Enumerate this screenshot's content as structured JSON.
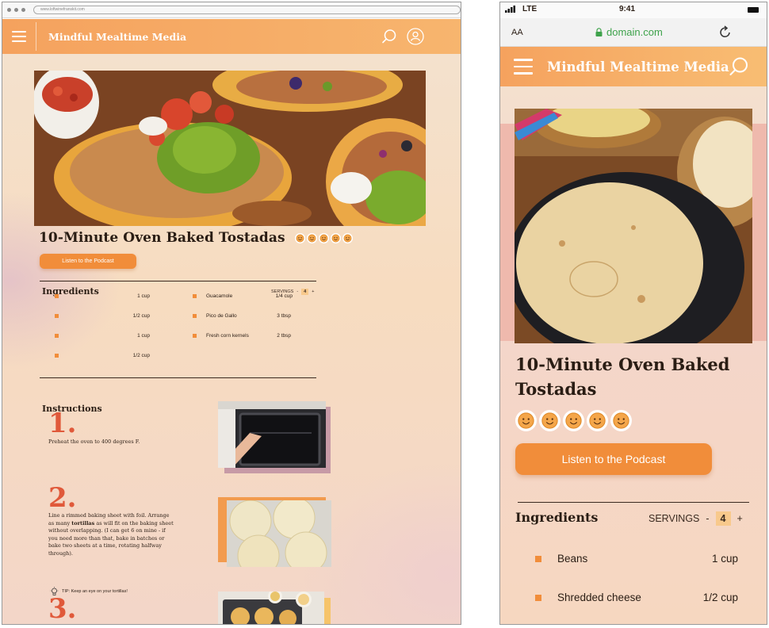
{
  "brand": "Mindful Mealtime Media",
  "desktop": {
    "url": "www.loftwinefranskit.com",
    "recipe_title": "10-Minute Oven Baked Tostadas",
    "podcast_label": "Listen to the Podcast",
    "ingredients_heading": "Ingredients",
    "servings_label": "SERVINGS",
    "servings_minus": "-",
    "servings_value": "4",
    "servings_plus": "+",
    "ingredients_left": [
      {
        "name": "",
        "qty": "1 cup"
      },
      {
        "name": "",
        "qty": "1/2 cup"
      },
      {
        "name": "",
        "qty": "1 cup"
      },
      {
        "name": "",
        "qty": "1/2 cup"
      }
    ],
    "ingredients_right": [
      {
        "name": "Guacamole",
        "qty": "1/4 cup"
      },
      {
        "name": "Pico de Gallo",
        "qty": "3 tbsp"
      },
      {
        "name": "Fresh corn kernels",
        "qty": "2 tbsp"
      }
    ],
    "instructions_heading": "Instructions",
    "steps": [
      {
        "number": "1.",
        "text": "Preheat the oven to 400 degrees F."
      },
      {
        "number": "2.",
        "text_before": "Line a rimmed baking sheet with foil. Arrange as many ",
        "bold": "tortillas",
        "text_after": " as will fit on the baking sheet without overlapping. (I can get 6 on mine - if you need more than that, bake in batches or bake two sheets at a time, rotating halfway through)."
      },
      {
        "number": "3.",
        "text": ""
      }
    ],
    "tip": "TIP: Keep an eye on your tortillas!"
  },
  "mobile": {
    "carrier": "LTE",
    "time": "9:41",
    "text_size_label": "AA",
    "domain": "domain.com",
    "recipe_title": "10-Minute Oven Baked Tostadas",
    "podcast_label": "Listen to the Podcast",
    "ingredients_heading": "Ingredients",
    "servings_label": "SERVINGS",
    "servings_minus": "-",
    "servings_value": "4",
    "servings_plus": "+",
    "ingredients": [
      {
        "name": "Beans",
        "qty": "1 cup"
      },
      {
        "name": "Shredded cheese",
        "qty": "1/2 cup"
      }
    ]
  },
  "colors": {
    "accent": "#f18d3a",
    "nav_gradient_start": "#f5a25e",
    "nav_gradient_end": "#f7b56e",
    "step_number": "#e0593a"
  },
  "icons": [
    "hamburger-menu-icon",
    "search-icon",
    "account-icon",
    "smiley-rating-icon",
    "lightbulb-icon",
    "lock-icon",
    "reload-icon",
    "signal-icon",
    "battery-icon"
  ],
  "rating": {
    "count": 5
  }
}
